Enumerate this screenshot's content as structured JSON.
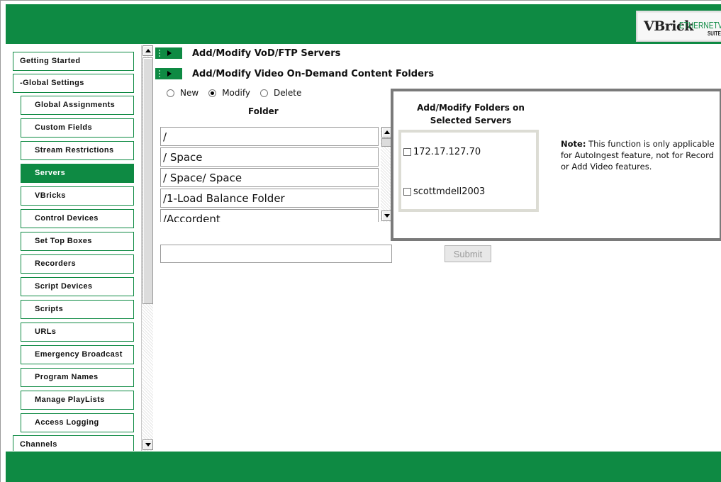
{
  "logo": {
    "brand": "VBrick",
    "product": "ETHERNETV",
    "edition": "SUITE"
  },
  "sidebar": {
    "items": [
      {
        "label": "Getting Started",
        "level": "top",
        "active": false
      },
      {
        "label": "-Global Settings",
        "level": "top",
        "active": false
      },
      {
        "label": "Global Assignments",
        "level": "sub",
        "active": false
      },
      {
        "label": "Custom Fields",
        "level": "sub",
        "active": false
      },
      {
        "label": "Stream Restrictions",
        "level": "sub",
        "active": false
      },
      {
        "label": "Servers",
        "level": "sub",
        "active": true
      },
      {
        "label": "VBricks",
        "level": "sub",
        "active": false
      },
      {
        "label": "Control Devices",
        "level": "sub",
        "active": false
      },
      {
        "label": "Set Top Boxes",
        "level": "sub",
        "active": false
      },
      {
        "label": "Recorders",
        "level": "sub",
        "active": false
      },
      {
        "label": "Script Devices",
        "level": "sub",
        "active": false
      },
      {
        "label": "Scripts",
        "level": "sub",
        "active": false
      },
      {
        "label": "URLs",
        "level": "sub",
        "active": false
      },
      {
        "label": "Emergency Broadcast",
        "level": "sub",
        "active": false
      },
      {
        "label": "Program Names",
        "level": "sub",
        "active": false
      },
      {
        "label": "Manage PlayLists",
        "level": "sub",
        "active": false
      },
      {
        "label": "Access Logging",
        "level": "sub",
        "active": false
      },
      {
        "label": "Channels",
        "level": "top",
        "active": false
      }
    ]
  },
  "sections": {
    "vod_servers": "Add/Modify VoD/FTP Servers",
    "vod_folders": "Add/Modify Video On-Demand Content Folders"
  },
  "mode": {
    "options": [
      "New",
      "Modify",
      "Delete"
    ],
    "selected": "Modify"
  },
  "folder": {
    "label": "Folder",
    "items": [
      "/",
      "/ Space",
      "/ Space/ Space",
      "/1-Load Balance Folder",
      "/Accordent"
    ]
  },
  "panel": {
    "title_line1": "Add/Modify Folders on",
    "title_line2": "Selected Servers",
    "servers": [
      {
        "name": "172.17.127.70",
        "checked": false
      },
      {
        "name": "scottmdell2003",
        "checked": false
      }
    ],
    "note_label": "Note:",
    "note_text": " This function is only applicable for AutoIngest feature, not for Record or Add Video features."
  },
  "form": {
    "folder_name_value": "",
    "submit_label": "Submit"
  },
  "colors": {
    "brand_green": "#0e8a43",
    "panel_border": "#7a7a7a"
  }
}
